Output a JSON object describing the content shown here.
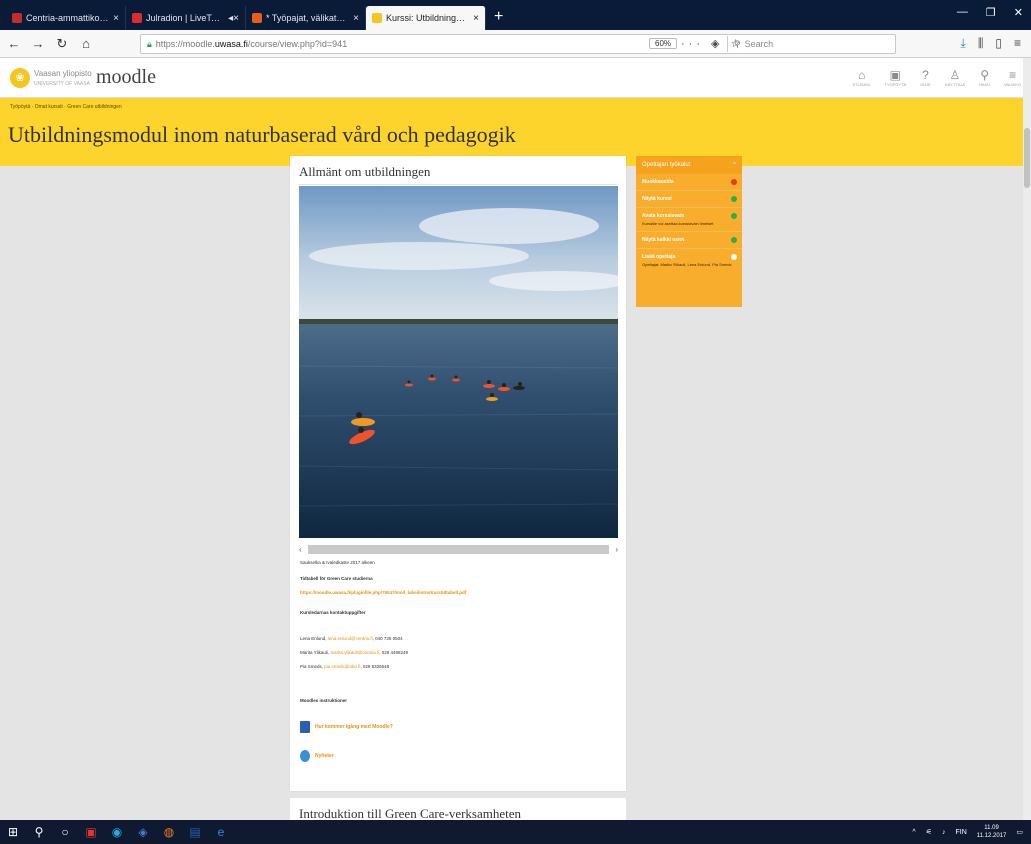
{
  "browser": {
    "tabs": [
      {
        "title": "Centria-ammattikorkeakoulu",
        "favicon_color": "#c32d2d",
        "active": false
      },
      {
        "title": "Julradion | LiveTaajuus.fi",
        "favicon_color": "#d62d2d",
        "active": false
      },
      {
        "title": "* Työpajat, välikatselmukset ja",
        "favicon_color": "#e85d1e",
        "active": false
      },
      {
        "title": "Kurssi: Utbildningsmodul inom",
        "favicon_color": "#f5c520",
        "active": true
      }
    ],
    "url_prefix": "https://moodle.",
    "url_host": "uwasa.fi",
    "url_path": "/course/view.php?id=941",
    "zoom": "60%",
    "search_placeholder": "Search"
  },
  "site": {
    "university": "Vaasan yliopisto",
    "university_sub": "UNIVERSITY OF VAASA",
    "brand": "moodle",
    "header_icons": [
      {
        "icon": "home-icon",
        "glyph": "⌂",
        "label": "Etusivu"
      },
      {
        "icon": "dashboard-icon",
        "glyph": "▣",
        "label": "Työpöytä"
      },
      {
        "icon": "help-icon",
        "glyph": "?",
        "label": "Ohje"
      },
      {
        "icon": "user-icon",
        "glyph": "♙",
        "label": "Käyttäjä"
      },
      {
        "icon": "search-icon",
        "glyph": "⚲",
        "label": "Haku"
      },
      {
        "icon": "menu-icon",
        "glyph": "≡",
        "label": "Valikko"
      }
    ]
  },
  "page": {
    "breadcrumb": "Työpöytä · Omat kurssit · Green Care utbildningen",
    "title": "Utbildningsmodul inom naturbaserad vård och pedagogik"
  },
  "section1": {
    "title": "Allmänt om utbildningen",
    "caption": "Saukselka & Ivaledkaste 2017 alkeen",
    "schedule_heading": "Tidtabell för Green Care studierna",
    "schedule_link": "https://moodle.uwasa.fi/pluginfile.php/79047/mod_label/intro/Kurstidtabell.pdf",
    "contacts_heading": "Kursledarnas kontaktuppgifter",
    "contacts": [
      {
        "name": "Lena Enlund, ",
        "email": "lena.enlund@centria.fi",
        "phone": ", 040 725 0504"
      },
      {
        "name": "Marita Ylikauli, ",
        "email": "marita.ylikauli@centria.fi",
        "phone": ", 029 4498249"
      },
      {
        "name": "Pia Smeds, ",
        "email": "pia.smeds@abo.fi",
        "phone": ", 029 5326548"
      }
    ],
    "instructions_heading": "Moodles instruktioner",
    "link_getting_started": "Hur kommer igång med Moodle?",
    "link_news": "Nyheter"
  },
  "section2": {
    "title": "Introduktion till Green Care-verksamheten"
  },
  "teacher_tools": {
    "title": "Opettajan työkalut",
    "items": [
      {
        "label": "Muokkaustila",
        "sub": "",
        "dot_color": "#e83a1f"
      },
      {
        "label": "Näytä kurssi",
        "sub": "",
        "dot_color": "#27b04a"
      },
      {
        "label": "Avata kurssiavain",
        "sub": "Kurssille voi asettaa kurssiavain ilmeiset",
        "dot_color": "#27b04a"
      },
      {
        "label": "Näytä kaikki osiot",
        "sub": "",
        "dot_color": "#27b04a"
      },
      {
        "label": "Lisää opettaja",
        "sub": "Opettajat: Marita Ylikauli, Lena Enlund, Pia Smeds",
        "dot_color": "#ffffff"
      }
    ]
  },
  "taskbar": {
    "lang": "FIN",
    "time": "11.09",
    "date": "11.12.2017"
  }
}
